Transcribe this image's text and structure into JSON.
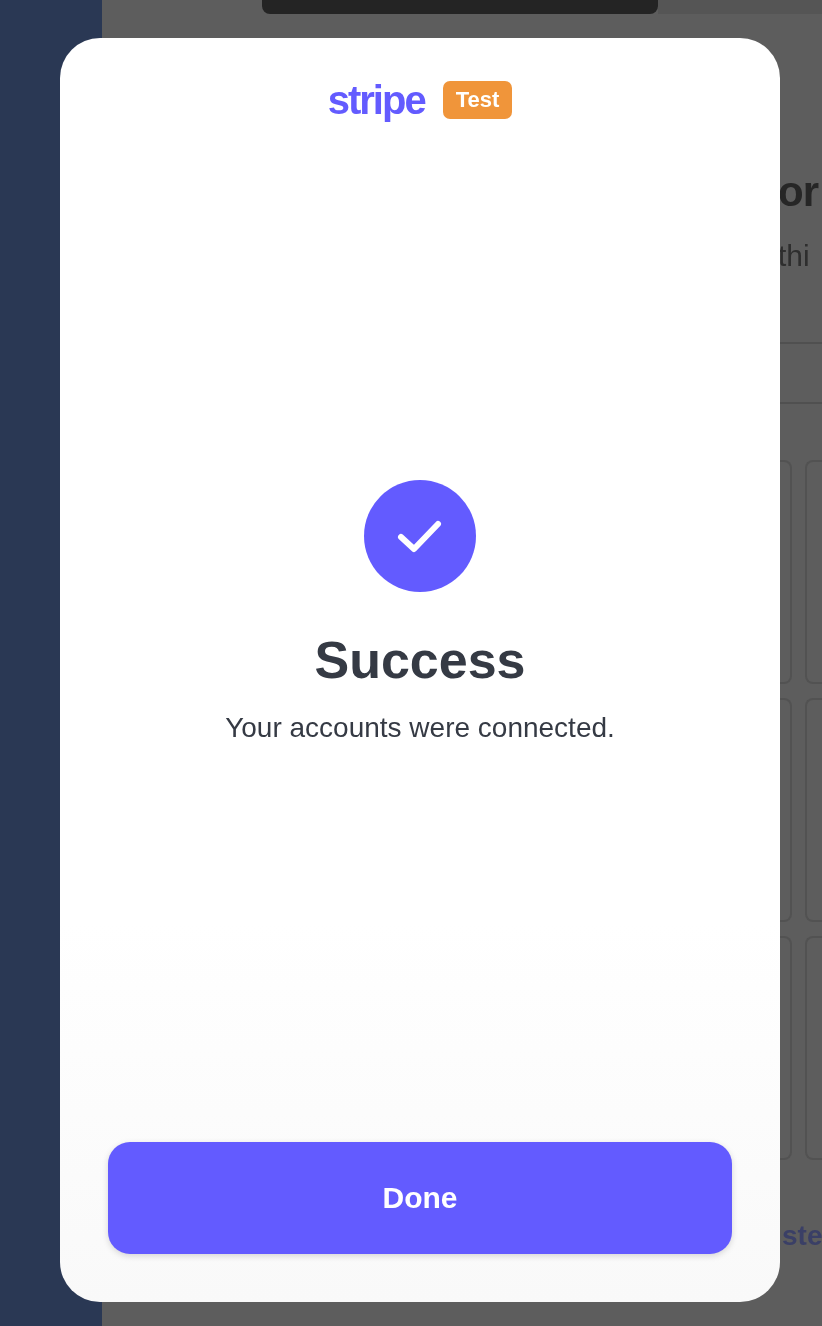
{
  "background_page": {
    "heading": "or",
    "subtitle": "thi",
    "link": "ste"
  },
  "modal": {
    "logo": "stripe",
    "badge": "Test",
    "title": "Success",
    "message": "Your accounts were connected.",
    "button": "Done"
  }
}
